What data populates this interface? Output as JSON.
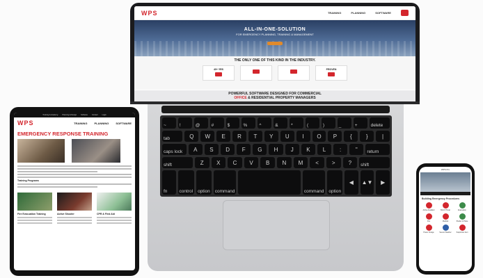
{
  "laptop": {
    "logo": "WPS",
    "nav": [
      "TRAINING",
      "PLANNING",
      "SOFTWARE"
    ],
    "hero_title": "ALL-IN-ONE-SOLUTION",
    "hero_subtitle": "FOR EMERGENCY PLANNING, TRAINING & MANAGEMENT",
    "tagline": "THE ONLY ONE OF THIS KIND IN THE INDUSTRY.",
    "boxes": [
      "40+ YRS",
      "",
      "",
      "PROVEN"
    ],
    "bottom_text_a": "POWERFUL SOFTWARE DESIGNED FOR COMMERCIAL",
    "bottom_text_b": "OFFICE",
    "bottom_text_c": "& RESIDENTIAL PROPERTY MANAGERS"
  },
  "keyboard": {
    "rows": [
      [
        "~",
        "!",
        "@",
        "#",
        "$",
        "%",
        "^",
        "&",
        "*",
        "(",
        ")",
        "_",
        "+",
        "delete"
      ],
      [
        "tab",
        "Q",
        "W",
        "E",
        "R",
        "T",
        "Y",
        "U",
        "I",
        "O",
        "P",
        "{",
        "}",
        "|"
      ],
      [
        "caps lock",
        "A",
        "S",
        "D",
        "F",
        "G",
        "H",
        "J",
        "K",
        "L",
        ":",
        "\"",
        "return"
      ],
      [
        "shift",
        "Z",
        "X",
        "C",
        "V",
        "B",
        "N",
        "M",
        "<",
        ">",
        "?",
        "shift"
      ],
      [
        "fn",
        "control",
        "option",
        "command",
        "",
        "command",
        "option",
        "◀",
        "▲▼",
        "▶"
      ]
    ]
  },
  "tablet": {
    "logo": "WPS",
    "top_links": [
      "Training & Academy",
      "Planning & Design",
      "Software",
      "Contact",
      "Login"
    ],
    "nav": [
      "TRAINING",
      "PLANNING",
      "SOFTWARE"
    ],
    "title": "EMERGENCY RESPONSE TRAINING",
    "subheading": "Training Programs",
    "col_titles": [
      "Fire Evacuation Training",
      "Active Shooter",
      "CPR & First Aid"
    ]
  },
  "phone": {
    "app_title": "WPS Pro",
    "section": "Building Emergency Procedures",
    "tiles": [
      "Active Assailant",
      "Bomb Threat",
      "Evacuation",
      "Fire",
      "Medical",
      "Shelter in Place",
      "Power Outage",
      "Severe Weather",
      "Suspicious Item"
    ]
  }
}
